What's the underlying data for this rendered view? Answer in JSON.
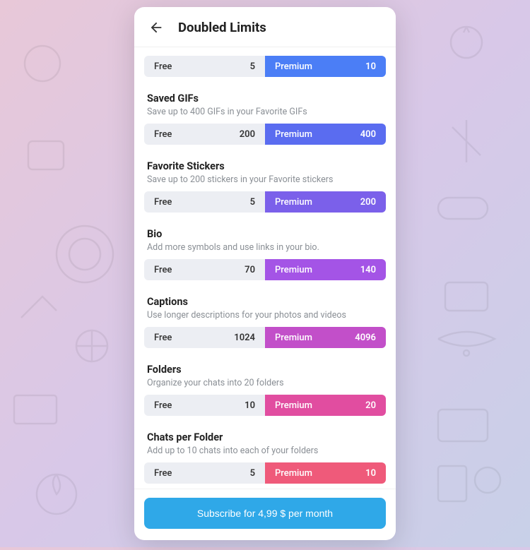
{
  "header": {
    "title": "Doubled Limits"
  },
  "labels": {
    "free": "Free",
    "premium": "Premium"
  },
  "items": [
    {
      "title": "",
      "desc": "",
      "free": "5",
      "premium": "10",
      "color": "#4b7ef6",
      "hideTitle": true
    },
    {
      "title": "Saved GIFs",
      "desc": "Save up to 400 GIFs in your Favorite GIFs",
      "free": "200",
      "premium": "400",
      "color": "#5a6cf0"
    },
    {
      "title": "Favorite Stickers",
      "desc": "Save up to 200 stickers in your Favorite stickers",
      "free": "5",
      "premium": "200",
      "color": "#7b60ea"
    },
    {
      "title": "Bio",
      "desc": "Add more symbols and use links in your bio.",
      "free": "70",
      "premium": "140",
      "color": "#a454e6"
    },
    {
      "title": "Captions",
      "desc": "Use longer descriptions for your photos and videos",
      "free": "1024",
      "premium": "4096",
      "color": "#c24fc9"
    },
    {
      "title": "Folders",
      "desc": "Organize your chats into 20 folders",
      "free": "10",
      "premium": "20",
      "color": "#e14da0"
    },
    {
      "title": "Chats per Folder",
      "desc": "Add up to 10 chats into each of your folders",
      "free": "5",
      "premium": "10",
      "color": "#ef5a7a"
    }
  ],
  "footer": {
    "subscribe": "Subscribe for 4,99 $ per month"
  }
}
